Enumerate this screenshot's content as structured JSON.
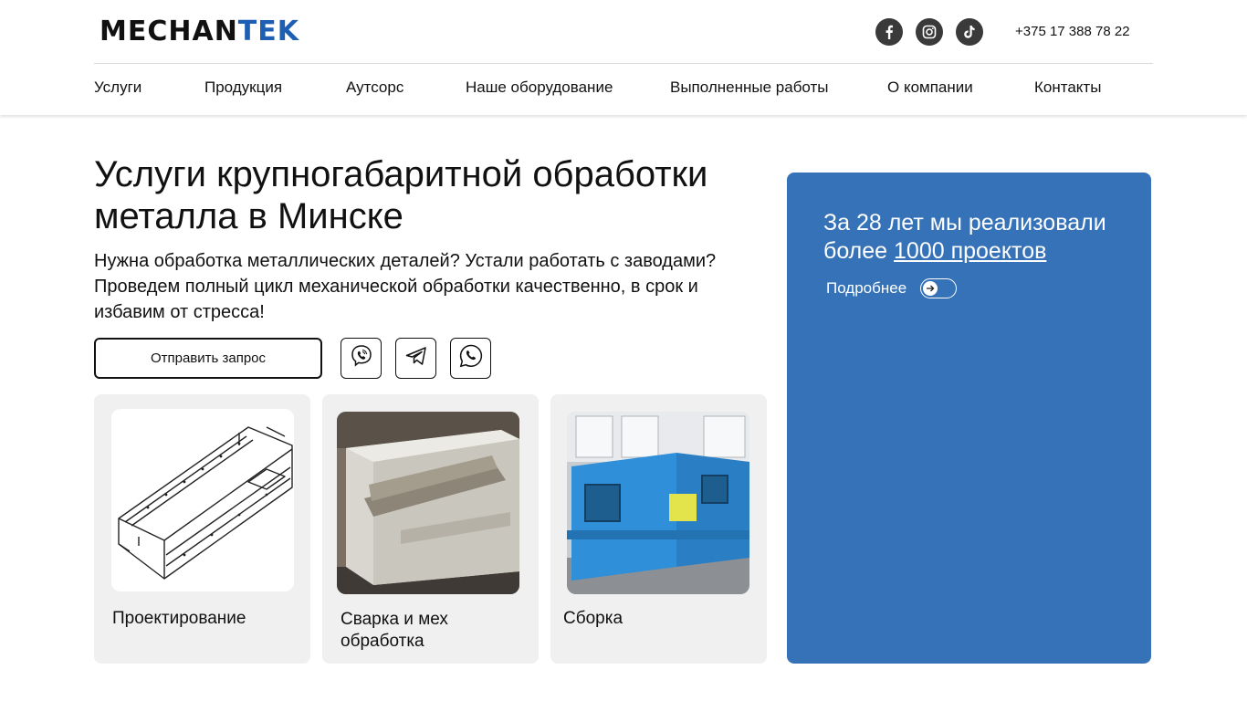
{
  "brand": {
    "logo_part1": "MECHAN",
    "logo_part2": "TEK",
    "accent": "#1e5fb4",
    "promo_bg": "#3572b8"
  },
  "header": {
    "socials": [
      {
        "icon": "facebook-icon"
      },
      {
        "icon": "instagram-icon"
      },
      {
        "icon": "tiktok-icon"
      }
    ],
    "phone": "+375 17 388 78 22"
  },
  "nav": {
    "items": [
      {
        "label": "Услуги"
      },
      {
        "label": "Продукция"
      },
      {
        "label": "Аутсорс"
      },
      {
        "label": "Наше оборудование"
      },
      {
        "label": "Выполненные работы"
      },
      {
        "label": "О компании"
      },
      {
        "label": "Контакты"
      }
    ]
  },
  "hero": {
    "title": "Услуги крупногабаритной обработки металла в Минске",
    "subtitle": "Нужна обработка металлических деталей? Устали работать с заводами? Проведем полный цикл механической обработки качественно, в срок и избавим от стресса!",
    "request_button": "Отправить запрос",
    "messengers": [
      {
        "icon": "viber-icon"
      },
      {
        "icon": "telegram-icon"
      },
      {
        "icon": "whatsapp-icon"
      }
    ]
  },
  "cards": [
    {
      "label": "Проектирование",
      "image": "engineering-drawing-image"
    },
    {
      "label": "Сварка и мех обработка",
      "image": "welded-frame-photo"
    },
    {
      "label": "Сборка",
      "image": "assembled-machine-photo"
    }
  ],
  "promo": {
    "text_before": "За 28 лет мы реализовали более ",
    "link_text": "1000 проектов",
    "more_label": "Подробнее"
  }
}
